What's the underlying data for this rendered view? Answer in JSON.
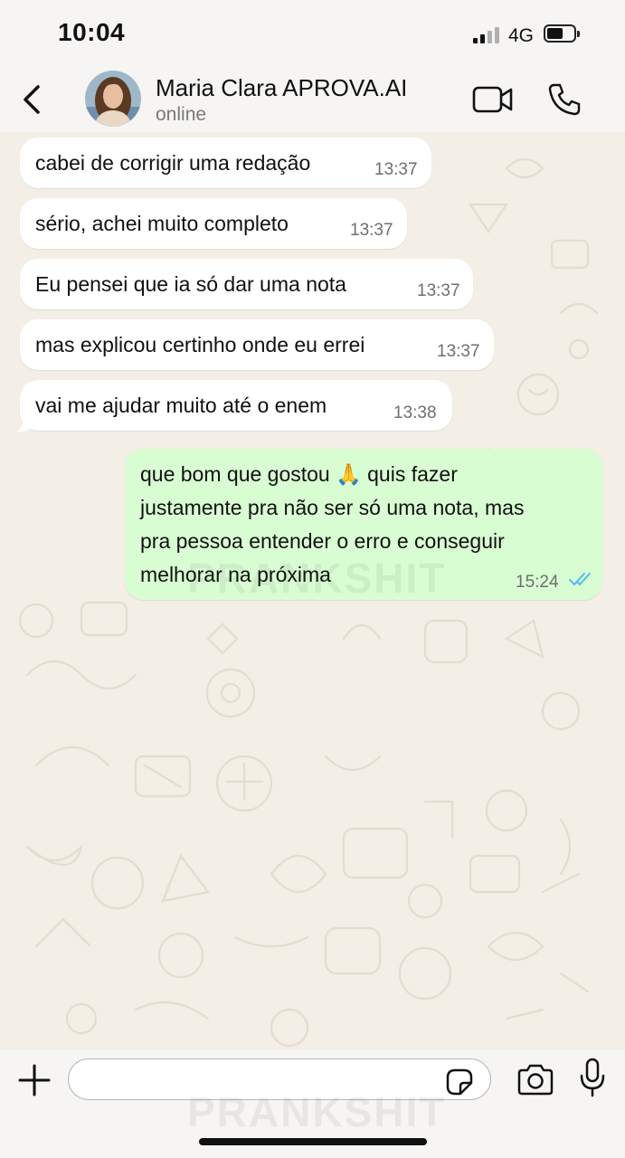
{
  "status_bar": {
    "time": "10:04",
    "network": "4G"
  },
  "header": {
    "contact_name": "Maria Clara APROVA.AI",
    "contact_status": "online"
  },
  "messages": [
    {
      "direction": "incoming",
      "text": "cabei de corrigir uma redação",
      "time": "13:37"
    },
    {
      "direction": "incoming",
      "text": "sério, achei muito completo",
      "time": "13:37"
    },
    {
      "direction": "incoming",
      "text": "Eu pensei que ia só dar uma nota",
      "time": "13:37"
    },
    {
      "direction": "incoming",
      "text": "mas explicou certinho onde eu errei",
      "time": "13:37"
    },
    {
      "direction": "incoming",
      "text": "vai me ajudar muito até o enem",
      "time": "13:38"
    },
    {
      "direction": "outgoing",
      "lines": [
        "que bom que gostou 🙏 quis fazer",
        "justamente pra não ser só uma nota, mas",
        "pra pessoa entender o erro e conseguir",
        "melhorar na próxima"
      ],
      "time": "15:24",
      "status": "read"
    }
  ],
  "watermark": "PRANKSHIT",
  "composer": {
    "placeholder": ""
  },
  "colors": {
    "incoming_bubble": "#ffffff",
    "outgoing_bubble": "#d9fdd3",
    "read_ticks": "#53bdeb",
    "wallpaper": "#f3eee6"
  }
}
